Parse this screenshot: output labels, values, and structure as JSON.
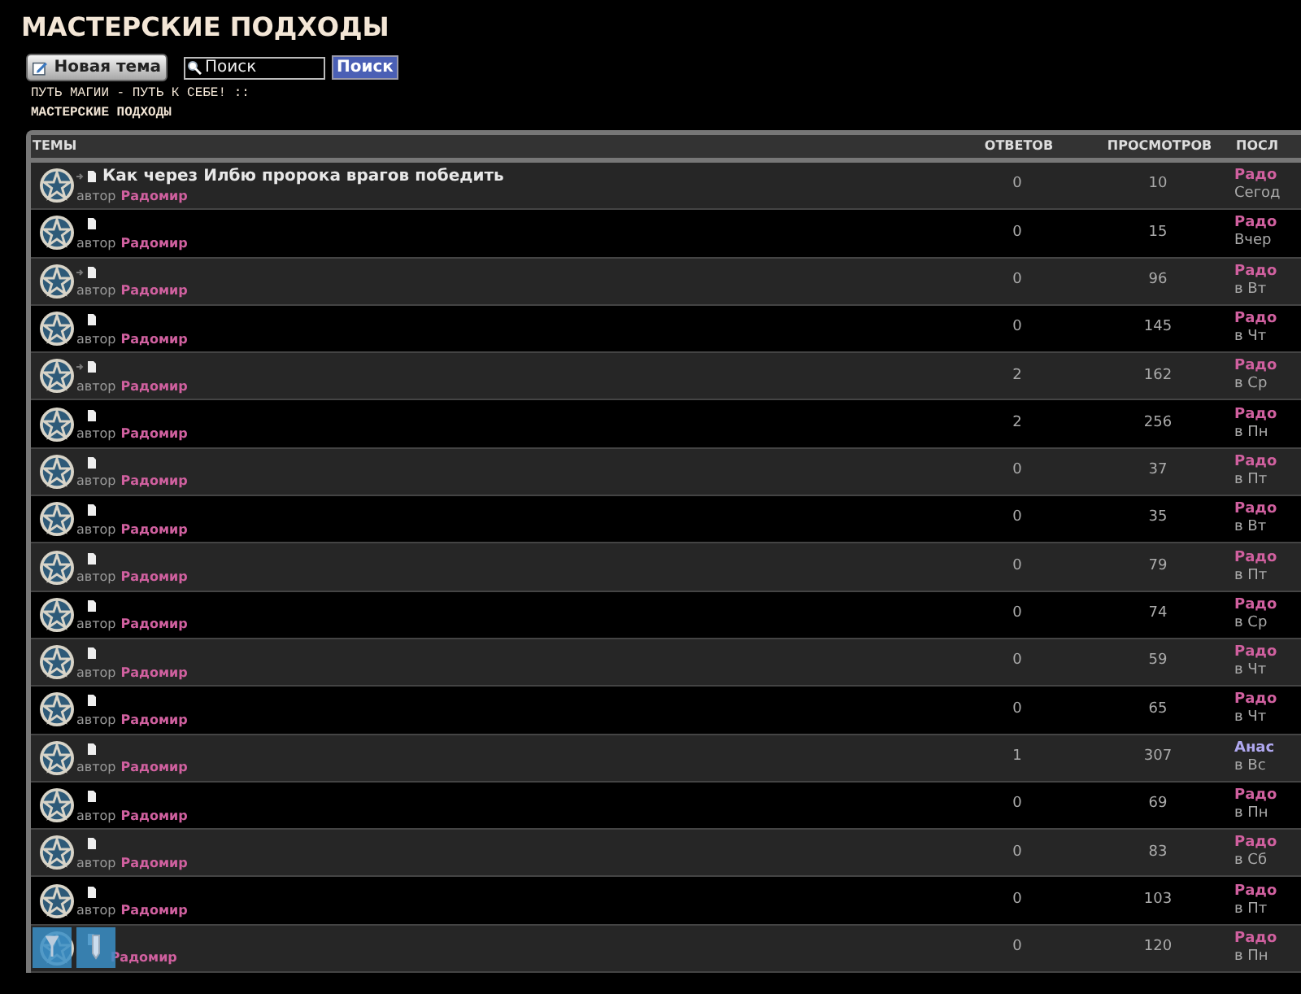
{
  "title": "МАСТЕРСКИЕ ПОДХОДЫ",
  "new_topic_button": "Новая тема",
  "search": {
    "value": "Поиск",
    "button": "Поиск"
  },
  "breadcrumb": [
    "ПУТЬ МАГИИ - ПУТЬ К СЕБЕ! ::",
    "МАСТЕРСКИЕ ПОДХОДЫ"
  ],
  "table": {
    "columns": [
      "ТЕМЫ",
      "ОТВЕТОВ",
      "ПРОСМОТРОВ",
      "ПОСЛ"
    ],
    "rows": [
      {
        "title": "Как через Илбю пророка врагов победить",
        "moved": true,
        "by": "автор",
        "author": "Радомир",
        "replies": "0",
        "views": "10",
        "last_post": {
          "author": "Радо",
          "color": "#d0609f",
          "date": "Сегод"
        }
      },
      {
        "moved": false,
        "by": "автор",
        "author": "Радомир",
        "replies": "0",
        "views": "15",
        "last_post": {
          "author": "Радо",
          "color": "#d0609f",
          "date": "Вчер"
        }
      },
      {
        "moved": true,
        "by": "автор",
        "author": "Радомир",
        "replies": "0",
        "views": "96",
        "last_post": {
          "author": "Радо",
          "color": "#d0609f",
          "date": "в Вт"
        }
      },
      {
        "moved": false,
        "by": "автор",
        "author": "Радомир",
        "replies": "0",
        "views": "145",
        "last_post": {
          "author": "Радо",
          "color": "#d0609f",
          "date": "в Чт"
        }
      },
      {
        "moved": true,
        "by": "автор",
        "author": "Радомир",
        "replies": "2",
        "views": "162",
        "last_post": {
          "author": "Радо",
          "color": "#d0609f",
          "date": "в Ср"
        }
      },
      {
        "moved": false,
        "by": "автор",
        "author": "Радомир",
        "replies": "2",
        "views": "256",
        "last_post": {
          "author": "Радо",
          "color": "#d0609f",
          "date": "в Пн"
        }
      },
      {
        "moved": false,
        "by": "автор",
        "author": "Радомир",
        "replies": "0",
        "views": "37",
        "last_post": {
          "author": "Радо",
          "color": "#d0609f",
          "date": "в Пт"
        }
      },
      {
        "moved": false,
        "by": "автор",
        "author": "Радомир",
        "replies": "0",
        "views": "35",
        "last_post": {
          "author": "Радо",
          "color": "#d0609f",
          "date": "в Вт"
        }
      },
      {
        "moved": false,
        "by": "автор",
        "author": "Радомир",
        "replies": "0",
        "views": "79",
        "last_post": {
          "author": "Радо",
          "color": "#d0609f",
          "date": "в Пт"
        }
      },
      {
        "moved": false,
        "by": "автор",
        "author": "Радомир",
        "replies": "0",
        "views": "74",
        "last_post": {
          "author": "Радо",
          "color": "#d0609f",
          "date": "в Ср"
        }
      },
      {
        "moved": false,
        "by": "автор",
        "author": "Радомир",
        "replies": "0",
        "views": "59",
        "last_post": {
          "author": "Радо",
          "color": "#d0609f",
          "date": "в Чт"
        }
      },
      {
        "moved": false,
        "by": "автор",
        "author": "Радомир",
        "replies": "0",
        "views": "65",
        "last_post": {
          "author": "Радо",
          "color": "#d0609f",
          "date": "в Чт"
        }
      },
      {
        "moved": false,
        "by": "автор",
        "author": "Радомир",
        "replies": "1",
        "views": "307",
        "last_post": {
          "author": "Анас",
          "color": "#b0a8f0",
          "date": "в Вс"
        }
      },
      {
        "moved": false,
        "by": "автор",
        "author": "Радомир",
        "replies": "0",
        "views": "69",
        "last_post": {
          "author": "Радо",
          "color": "#d0609f",
          "date": "в Пн"
        }
      },
      {
        "moved": false,
        "by": "автор",
        "author": "Радомир",
        "replies": "0",
        "views": "83",
        "last_post": {
          "author": "Радо",
          "color": "#d0609f",
          "date": "в Сб"
        }
      },
      {
        "moved": false,
        "by": "автор",
        "author": "Радомир",
        "replies": "0",
        "views": "103",
        "last_post": {
          "author": "Радо",
          "color": "#d0609f",
          "date": "в Пт"
        }
      },
      {
        "moved": false,
        "author": "Радомир",
        "replies": "0",
        "views": "120",
        "last_post": {
          "author": "Радо",
          "color": "#d0609f",
          "date": "в Пн"
        },
        "hover_tools": true
      }
    ]
  }
}
